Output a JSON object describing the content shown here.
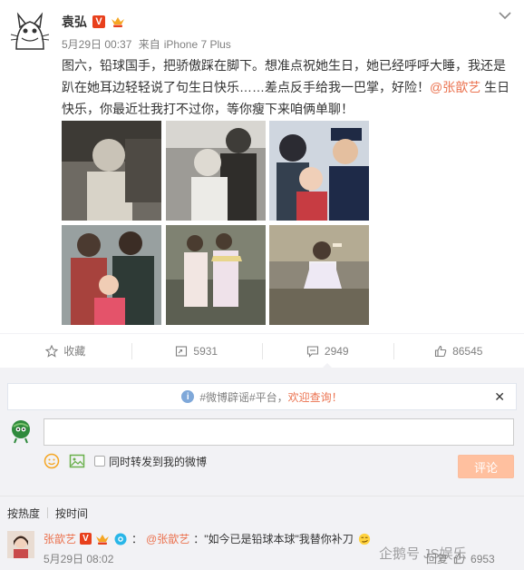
{
  "post": {
    "author": "袁弘",
    "time": "5月29日 00:37",
    "source_prefix": "来自",
    "source": "iPhone 7 Plus",
    "text_before": "图六，铅球国手，把骄傲踩在脚下。想准点祝她生日，她已经呼呼大睡，我还是趴在她耳边轻轻说了句生日快乐……差点反手给我一巴掌，好险！",
    "mention": "@张歆艺",
    "text_after": " 生日快乐，你最近壮我打不过你，等你瘦下来咱俩单聊！"
  },
  "actions": {
    "favorite": "收藏",
    "repost": "5931",
    "comment": "2949",
    "like": "86545"
  },
  "comments_panel": {
    "notice_tag": "#微博辟谣#平台，",
    "notice_welcome": "欢迎查询！",
    "input_placeholder": "",
    "repost_checkbox_label": "同时转发到我的微博",
    "submit_label": "评论",
    "sort_hot": "按热度",
    "sort_time": "按时间"
  },
  "comment": {
    "name": "张歆艺",
    "separator": "：",
    "mention": "@张歆艺",
    "text": "：\"如今已是铅球本球\"我替你补刀",
    "time": "5月29日 08:02",
    "reply": "回复",
    "like_count": "6953"
  },
  "watermark": "企鹅号 JS娱乐",
  "colors": {
    "accent": "#eb7350",
    "background": "#f2f2f5",
    "submit": "#ffc09f"
  }
}
